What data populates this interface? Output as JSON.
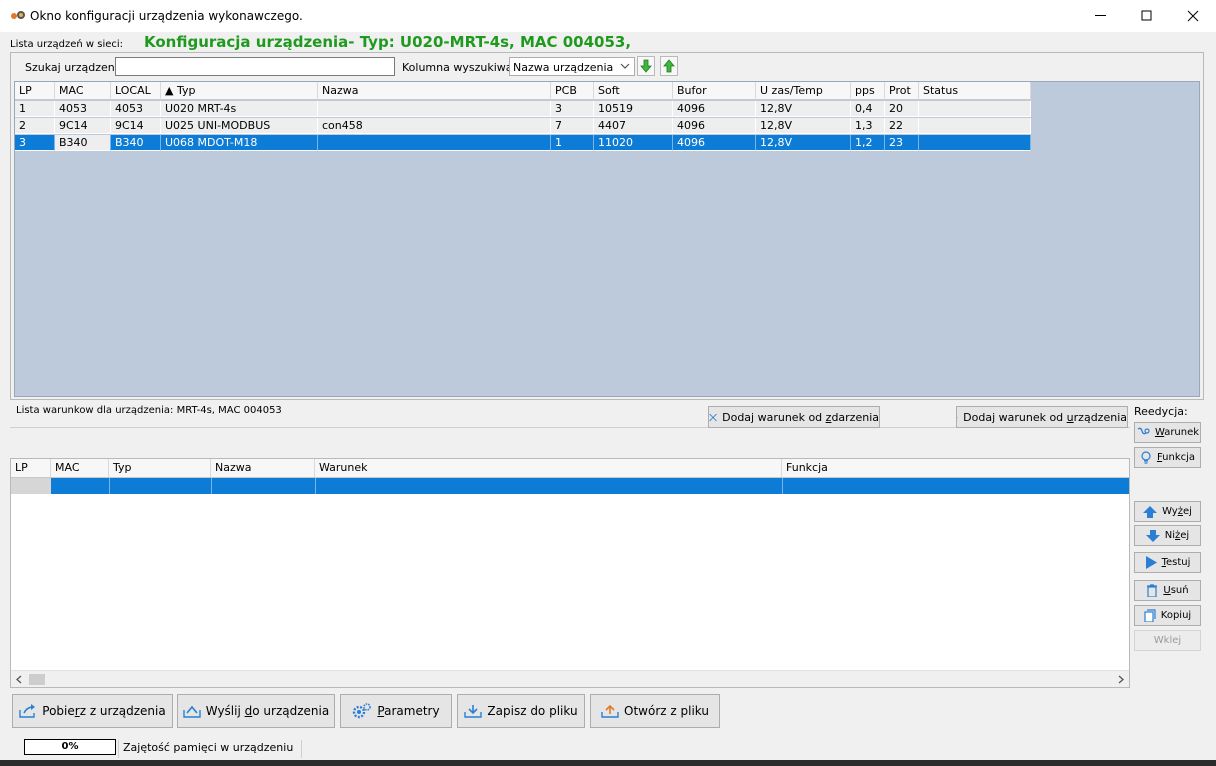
{
  "window": {
    "title": "Okno konfiguracji urządzenia wykonawczego.",
    "minimize": "—",
    "maximize": "☐",
    "close": "✕"
  },
  "header": {
    "list_label": "Lista urządzeń w sieci:",
    "config_title": "Konfiguracja urządzenia- Typ: U020-MRT-4s, MAC 004053,"
  },
  "search": {
    "label": "Szukaj urządzenia:",
    "value": "",
    "column_label": "Kolumna wyszukiwania:",
    "column_value": "Nazwa urządzenia"
  },
  "device_table": {
    "columns": [
      "LP",
      "MAC",
      "LOCAL",
      "▲ Typ",
      "Nazwa",
      "PCB",
      "Soft",
      "Bufor",
      "U zas/Temp",
      "pps",
      "Prot",
      "Status"
    ],
    "rows": [
      [
        "1",
        "4053",
        "4053",
        "U020 MRT-4s",
        "",
        "3",
        "10519",
        "4096",
        "12,8V",
        "0,4",
        "20",
        ""
      ],
      [
        "2",
        "9C14",
        "9C14",
        "U025 UNI-MODBUS",
        "con458",
        "7",
        "4407",
        "4096",
        "12,8V",
        "1,3",
        "22",
        ""
      ],
      [
        "3",
        "B340",
        "B340",
        "U068 MDOT-M18",
        "",
        "1",
        "11020",
        "4096",
        "12,8V",
        "1,2",
        "23",
        ""
      ]
    ],
    "selected_row": 3
  },
  "conditions": {
    "label": "Lista warunkow dla urządzenia: MRT-4s, MAC 004053",
    "add_event_pre": "Dodaj warunek od ",
    "add_event_u": "z",
    "add_event_post": "darzenia",
    "add_device_pre": "Dodaj warunek od ",
    "add_device_u": "u",
    "add_device_post": "rządzenia",
    "columns": [
      "LP",
      "MAC",
      "Typ",
      "Nazwa",
      "Warunek",
      "Funkcja"
    ]
  },
  "side": {
    "reedycja_label": "Reedycja:",
    "warunek_u": "W",
    "warunek_rest": "arunek",
    "funkcja_u": "F",
    "funkcja_rest": "unkcja",
    "wyzej_pre": "Wy",
    "wyzej_u": "ż",
    "wyzej_post": "ej",
    "nizej_pre": "Ni",
    "nizej_u": "ż",
    "nizej_post": "ej",
    "testuj_u": "T",
    "testuj_rest": "estuj",
    "usun_u": "U",
    "usun_rest": "suń",
    "kopiuj": "Kopiuj",
    "wklej": "Wklej"
  },
  "bottom": {
    "pobierz_pre": "Pobie",
    "pobierz_u": "r",
    "pobierz_post": "z z urządzenia",
    "wyslij_pre": "Wyślij ",
    "wyslij_u": "d",
    "wyslij_post": "o urządzenia",
    "parametry_u": "P",
    "parametry_rest": "arametry",
    "zapisz": "Zapisz do pliku",
    "otworz": "Otwórz z pliku"
  },
  "status": {
    "progress": "0%",
    "memory_label": "Zajętość pamięci w urządzeniu"
  },
  "colors": {
    "accent_green": "#1f9a1f",
    "selection_blue": "#0d7cd6",
    "table_bg": "#bccadb"
  }
}
